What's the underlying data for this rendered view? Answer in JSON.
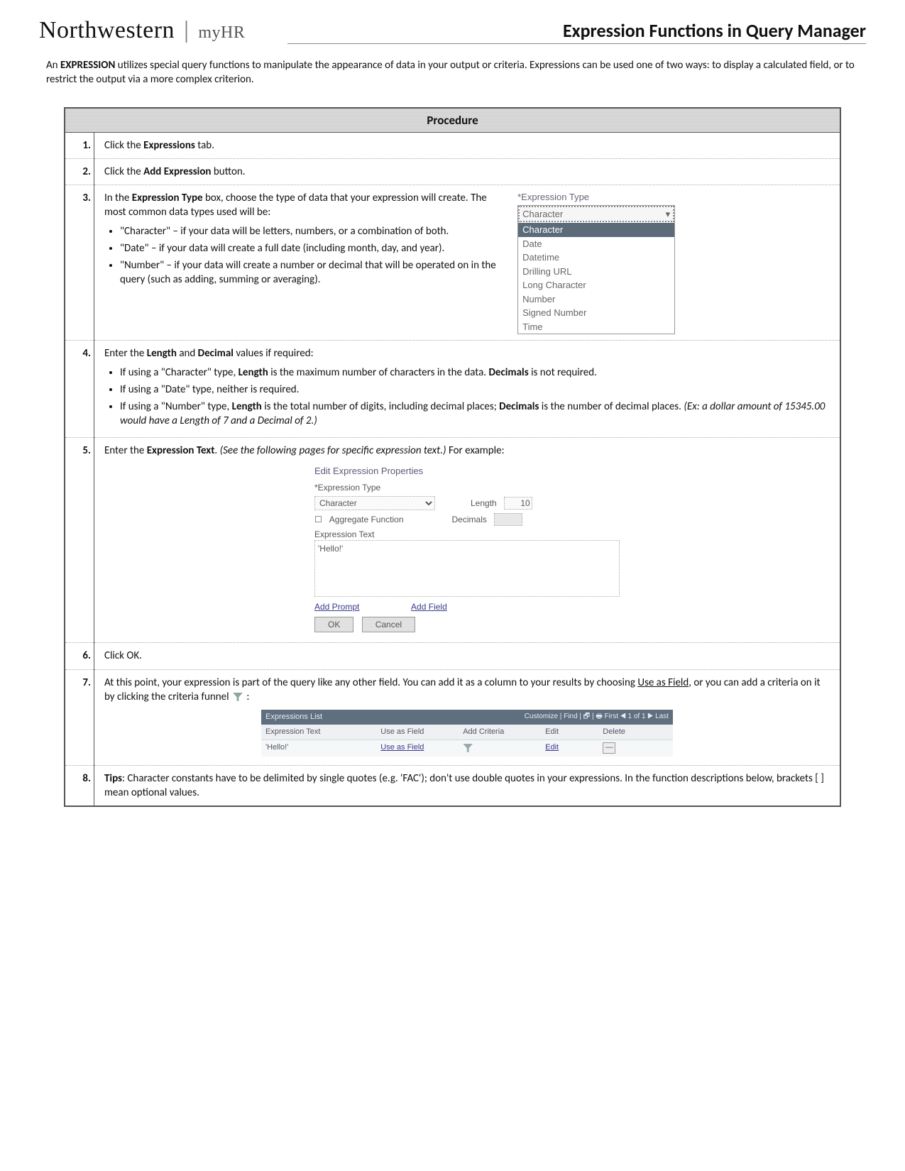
{
  "header": {
    "brand": "Northwestern",
    "brand_sub": "myHR",
    "title": "Expression Functions in Query Manager"
  },
  "intro": {
    "lead": "EXPRESSION",
    "pre": "An ",
    "post": " utilizes special query functions to manipulate the appearance of data in your output or criteria. Expressions can be used one of two ways: to display a calculated field, or to restrict the output via a more complex criterion."
  },
  "table": {
    "heading": "Procedure",
    "rows": {
      "r1": {
        "n": "1.",
        "a": "Click the ",
        "b": "Expressions",
        "c": " tab."
      },
      "r2": {
        "n": "2.",
        "a": "Click the ",
        "b": "Add Expression",
        "c": " button."
      },
      "r3": {
        "n": "3.",
        "a": "In the ",
        "b": "Expression Type",
        "c": " box, choose the type of data that your expression will create. The most common data types used will be:",
        "li1": "\"Character\" – if your data will be letters, numbers, or a combination of both.",
        "li2": "\"Date\" – if your data will create a full date (including month, day, and year).",
        "li3": "\"Number\" – if your data will create a number or decimal that will be operated on in the query (such as adding, summing or averaging).",
        "dd_label": "*Expression Type",
        "dd_sel": "Character",
        "dd_opts": [
          "Character",
          "Date",
          "Datetime",
          "Drilling URL",
          "Long Character",
          "Number",
          "Signed Number",
          "Time"
        ]
      },
      "r4": {
        "n": "4.",
        "a": "Enter the ",
        "b1": "Length",
        "mid": " and ",
        "b2": "Decimal",
        "c": " values if required:",
        "li1a": "If using a \"Character\" type, ",
        "li1b": "Length",
        "li1c": " is the maximum number of characters in the data. ",
        "li1d": "Decimals",
        "li1e": " is not required.",
        "li2": "If using a \"Date\" type, neither is required.",
        "li3a": "If using a \"Number\" type, ",
        "li3b": "Length",
        "li3c": " is the total number of digits, including decimal places; ",
        "li3d": "Decimals",
        "li3e": " is the number of decimal places. ",
        "li3f": "(Ex: a dollar amount of 15345.00 would have a Length of 7 and a Decimal of 2.)"
      },
      "r5": {
        "n": "5.",
        "a": "Enter the ",
        "b": "Expression Text",
        "c": ". ",
        "d": "(See the following pages for specific expression text.)",
        "e": " For example:",
        "box": {
          "title": "Edit Expression Properties",
          "type_lbl": "*Expression Type",
          "type_val": "Character",
          "len_lbl": "Length",
          "len_val": "10",
          "agg": "Aggregate Function",
          "dec_lbl": "Decimals",
          "text_lbl": "Expression Text",
          "text_val": "'Hello!'",
          "link1": "Add Prompt",
          "link2": "Add Field",
          "ok": "OK",
          "cancel": "Cancel"
        }
      },
      "r6": {
        "n": "6.",
        "a": "Click OK."
      },
      "r7": {
        "n": "7.",
        "a": "At this point, your expression is part of the query like any other field. You can add it as a column to your results by choosing ",
        "b": "Use as Field",
        "c": ", or you can add a criteria on it by clicking the criteria funnel ",
        "d": " :",
        "list": {
          "title": "Expressions List",
          "right": "Customize | Find |  🗗  |  🖶   First  ◀ 1 of 1 ▶  Last",
          "h1": "Expression Text",
          "h2": "Use as Field",
          "h3": "Add Criteria",
          "h4": "Edit",
          "h5": "Delete",
          "d1": "'Hello!'",
          "d2": "Use as Field",
          "d4": "Edit"
        }
      },
      "r8": {
        "n": "8.",
        "a": "Tips",
        "b": ": Character constants have to be delimited by single quotes (e.g. 'FAC'); don't use double quotes in your expressions. In the function descriptions below, brackets [ ] mean optional values."
      }
    }
  }
}
